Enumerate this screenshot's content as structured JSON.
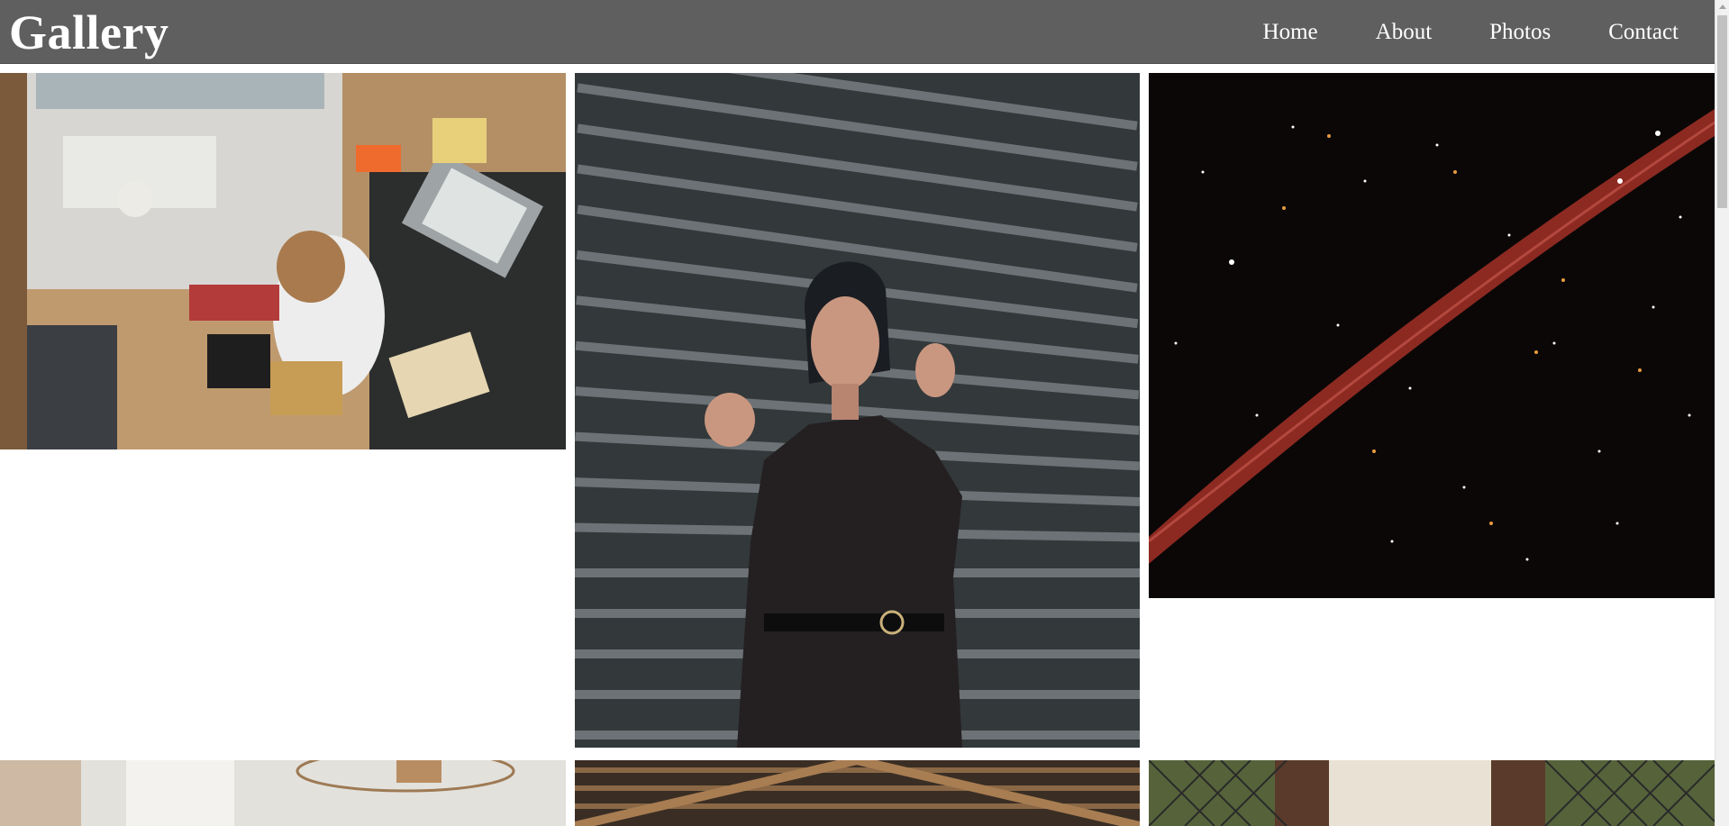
{
  "header": {
    "title": "Gallery",
    "nav": [
      {
        "label": "Home"
      },
      {
        "label": "About"
      },
      {
        "label": "Photos"
      },
      {
        "label": "Contact"
      }
    ]
  },
  "gallery": {
    "photos": [
      {
        "subject": "person working at desk with laptop, top-down view"
      },
      {
        "subject": "woman in black satin outfit against striped shutter wall"
      },
      {
        "subject": "starfield with red light streak"
      },
      {
        "subject": "bright room with rattan pendant lamp"
      },
      {
        "subject": "wooden roof beams"
      },
      {
        "subject": "person in white skirt by chain-link fence"
      }
    ]
  },
  "colors": {
    "header_bg": "#5f5f5f",
    "header_text": "#ffffff",
    "page_bg": "#ffffff"
  }
}
